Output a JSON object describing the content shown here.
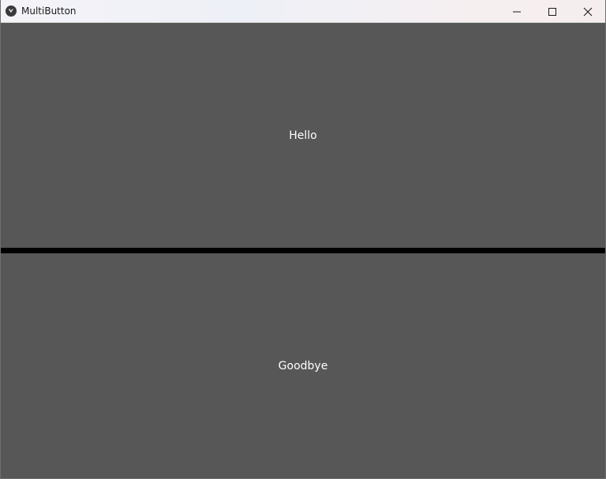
{
  "window": {
    "title": "MultiButton"
  },
  "buttons": {
    "top_label": "Hello",
    "bottom_label": "Goodbye"
  },
  "colors": {
    "button_bg": "#575757",
    "separator": "#000000",
    "text": "#ffffff"
  },
  "icons": {
    "app": "kivy-logo-icon",
    "minimize": "minimize-icon",
    "maximize": "maximize-icon",
    "close": "close-icon"
  }
}
